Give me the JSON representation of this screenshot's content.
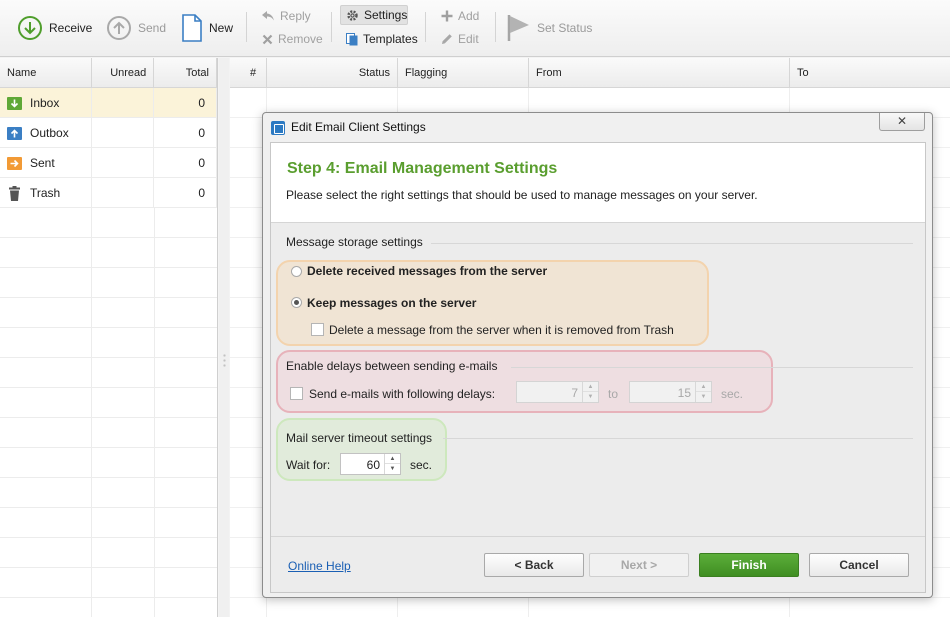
{
  "toolbar": {
    "receive": "Receive",
    "send": "Send",
    "new": "New",
    "reply": "Reply",
    "remove": "Remove",
    "settings": "Settings",
    "templates": "Templates",
    "add": "Add",
    "edit": "Edit",
    "set_status": "Set Status"
  },
  "folders": {
    "headers": {
      "name": "Name",
      "unread": "Unread",
      "total": "Total"
    },
    "items": [
      {
        "name": "Inbox",
        "total": "0",
        "icon": "inbox-icon",
        "color": "#5fa836"
      },
      {
        "name": "Outbox",
        "total": "0",
        "icon": "outbox-icon",
        "color": "#3b7fc4"
      },
      {
        "name": "Sent",
        "total": "0",
        "icon": "sent-icon",
        "color": "#f29a35"
      },
      {
        "name": "Trash",
        "total": "0",
        "icon": "trash-icon",
        "color": "#555555"
      }
    ]
  },
  "messages": {
    "headers": {
      "num": "#",
      "status": "Status",
      "flagging": "Flagging",
      "from": "From",
      "to": "To"
    }
  },
  "dialog": {
    "title": "Edit Email Client Settings",
    "close": "✕",
    "step_title": "Step 4: Email Management Settings",
    "step_desc": "Please select the right settings that should be used to manage messages on your server.",
    "storage": {
      "label": "Message storage settings",
      "opt_delete": "Delete received messages from the server",
      "opt_keep": "Keep messages on the server",
      "opt_delete_on_trash": "Delete a message from the server when it is removed from Trash"
    },
    "delays": {
      "label": "Enable delays between sending e-mails",
      "send_with_delays": "Send e-mails with following delays:",
      "from_value": "7",
      "to_label": "to",
      "to_value": "15",
      "unit": "sec."
    },
    "timeout": {
      "label": "Mail server timeout settings",
      "wait_for": "Wait for:",
      "value": "60",
      "unit": "sec."
    },
    "footer": {
      "help": "Online Help",
      "back": "< Back",
      "next": "Next >",
      "finish": "Finish",
      "cancel": "Cancel"
    }
  },
  "colors": {
    "accent_green": "#5a9e2f",
    "finish_button": "#4a9a2a",
    "link_blue": "#1a5fb4",
    "selected_row": "#fbf3d9"
  }
}
